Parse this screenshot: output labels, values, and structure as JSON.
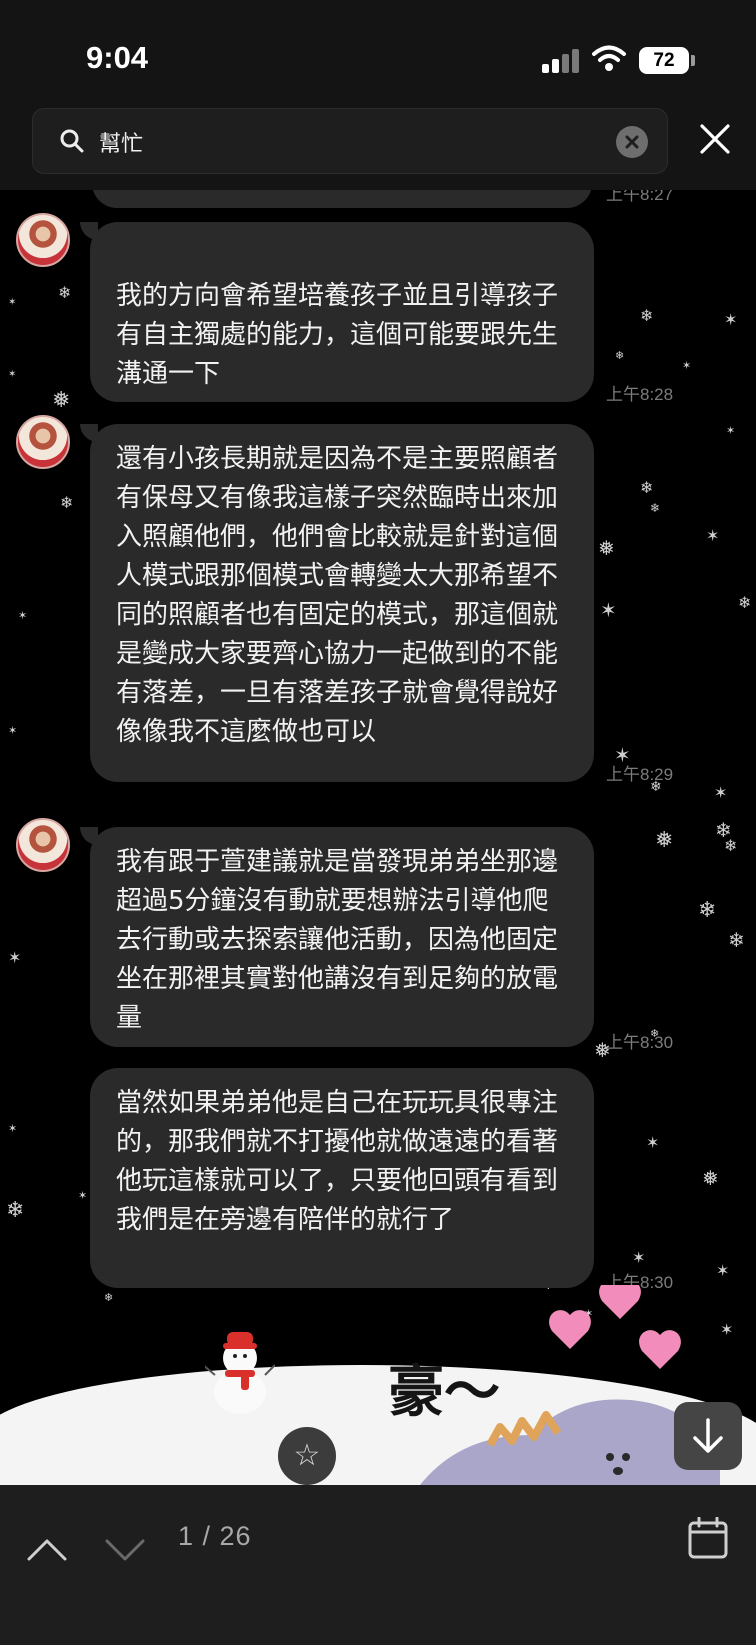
{
  "status_bar": {
    "time": "9:04",
    "battery": "72"
  },
  "search": {
    "query": "幫忙"
  },
  "chat": {
    "previous_time": "上午8:27",
    "messages": [
      {
        "text": "\n我的方向會希望培養孩子並且引導孩子有自主獨處的能力，這個可能要跟先生溝通一下",
        "time": "上午8:28"
      },
      {
        "text": "還有小孩長期就是因為不是主要照顧者有保母又有像我這樣子突然臨時出來加入照顧他們，他們會比較就是針對這個人模式跟那個模式會轉變太大那希望不同的照顧者也有固定的模式，那這個就是變成大家要齊心協力一起做到的不能有落差，一旦有落差孩子就會覺得說好像像我不這麼做也可以",
        "time": "上午8:29"
      },
      {
        "text": "我有跟于萱建議就是當發現弟弟坐那邊超過5分鐘沒有動就要想辦法引導他爬去行動或去探索讓他活動，因為他固定坐在那裡其實對他講沒有到足夠的放電量",
        "time": "上午8:30"
      },
      {
        "text": "當然如果弟弟他是自己在玩玩具很專注的，那我們就不打擾他就做遠遠的看著他玩這樣就可以了，只要他回頭有看到我們是在旁邊有陪伴的就行了",
        "time": "上午8:30"
      }
    ],
    "sticker_text": "豪～"
  },
  "bottom_bar": {
    "counter": "1 / 26"
  },
  "icons": {
    "search": "search-icon",
    "clear": "clear-icon",
    "close": "close-icon",
    "star": "star-icon",
    "scroll_down": "arrow-down-icon",
    "up": "chevron-up-icon",
    "down": "chevron-down-icon",
    "calendar": "calendar-icon"
  },
  "colors": {
    "background": "#000000",
    "bubble": "#2a2a2a",
    "bar": "#1e1e1e",
    "timestamp": "#7c7c7c"
  }
}
